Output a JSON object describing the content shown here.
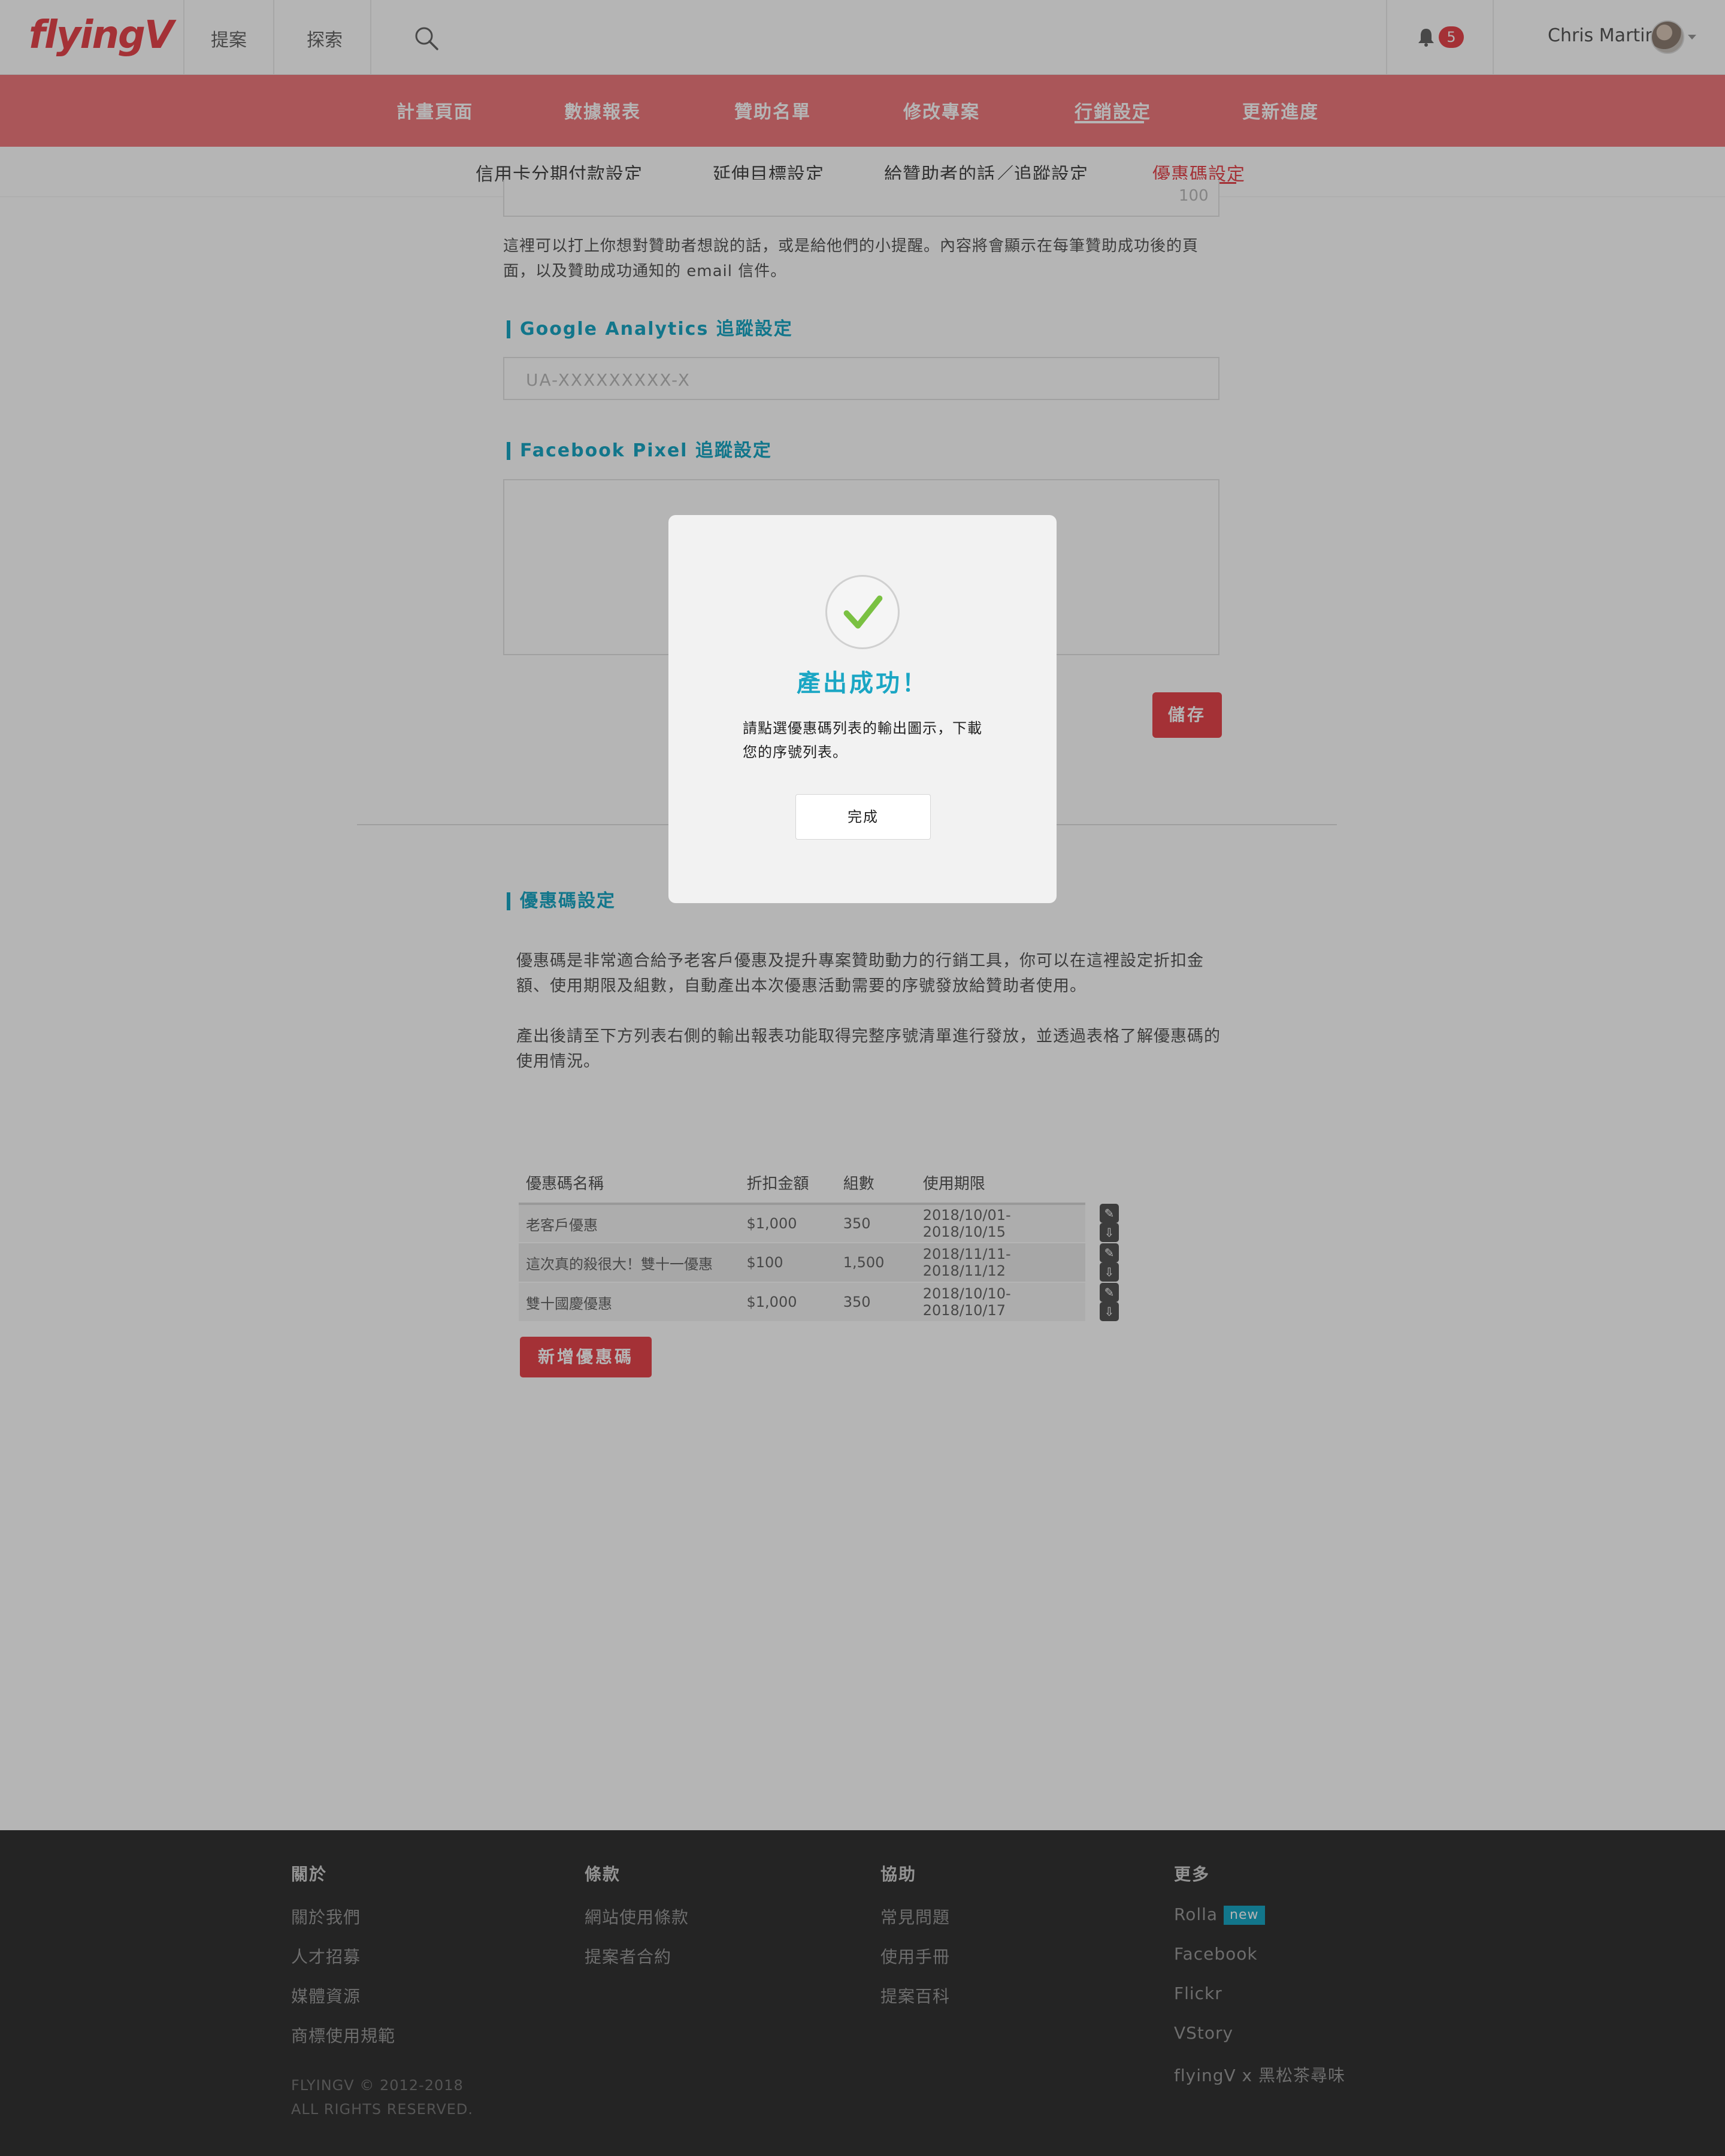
{
  "header": {
    "logo": "flyingV",
    "nav": [
      "提案",
      "探索"
    ],
    "notification_count": "5",
    "user_name": "Chris Martin"
  },
  "project_tabs": [
    "計畫頁面",
    "數據報表",
    "贊助名單",
    "修改專案",
    "行銷設定",
    "更新進度"
  ],
  "project_tabs_active": "行銷設定",
  "marketing_tabs": [
    "信用卡分期付款設定",
    "延伸目標設定",
    "給贊助者的話／追蹤設定",
    "優惠碼設定"
  ],
  "marketing_tabs_active": "優惠碼設定",
  "sponsor_message": {
    "counter": "100",
    "help": "這裡可以打上你想對贊助者想說的話，或是給他們的小提醒。內容將會顯示在每筆贊助成功後的頁面，以及贊助成功通知的 email 信件。"
  },
  "ga": {
    "title": "Google Analytics 追蹤設定",
    "placeholder": "UA-XXXXXXXXX-X"
  },
  "fb_pixel": {
    "title": "Facebook Pixel 追蹤設定"
  },
  "save_label": "儲存",
  "coupon": {
    "title": "優惠碼設定",
    "desc1": "優惠碼是非常適合給予老客戶優惠及提升專案贊助動力的行銷工具，你可以在這裡設定折扣金額、使用期限及組數，自動產出本次優惠活動需要的序號發放給贊助者使用。",
    "desc2": "產出後請至下方列表右側的輸出報表功能取得完整序號清單進行發放，並透過表格了解優惠碼的使用情況。",
    "columns": [
      "優惠碼名稱",
      "折扣金額",
      "組數",
      "使用期限"
    ],
    "rows": [
      {
        "name": "老客戶優惠",
        "amount": "$1,000",
        "count": "350",
        "period": "2018/10/01-2018/10/15"
      },
      {
        "name": "這次真的殺很大！雙十一優惠",
        "amount": "$100",
        "count": "1,500",
        "period": "2018/11/11-2018/11/12"
      },
      {
        "name": "雙十國慶優惠",
        "amount": "$1,000",
        "count": "350",
        "period": "2018/10/10-2018/10/17"
      }
    ],
    "add_label": "新增優惠碼"
  },
  "footer": {
    "columns": [
      {
        "title": "關於",
        "links": [
          "關於我們",
          "人才招募",
          "媒體資源",
          "商標使用規範"
        ]
      },
      {
        "title": "條款",
        "links": [
          "網站使用條款",
          "提案者合約"
        ]
      },
      {
        "title": "協助",
        "links": [
          "常見問題",
          "使用手冊",
          "提案百科"
        ]
      },
      {
        "title": "更多",
        "links": [
          "Rolla",
          "Facebook",
          "Flickr",
          "VStory",
          "flyingV x 黑松茶尋味"
        ]
      }
    ],
    "new_tag": "new",
    "copyright1": "FLYINGV © 2012-2018",
    "copyright2": "ALL RIGHTS RESERVED."
  },
  "modal": {
    "title": "產出成功！",
    "message": "請點選優惠碼列表的輸出圖示，下載您的序號列表。",
    "done_label": "完成"
  },
  "colors": {
    "brand_red": "#e8464c",
    "accent_teal": "#1aa6c4",
    "success_green": "#7ac142",
    "footer_bg": "#333333"
  }
}
